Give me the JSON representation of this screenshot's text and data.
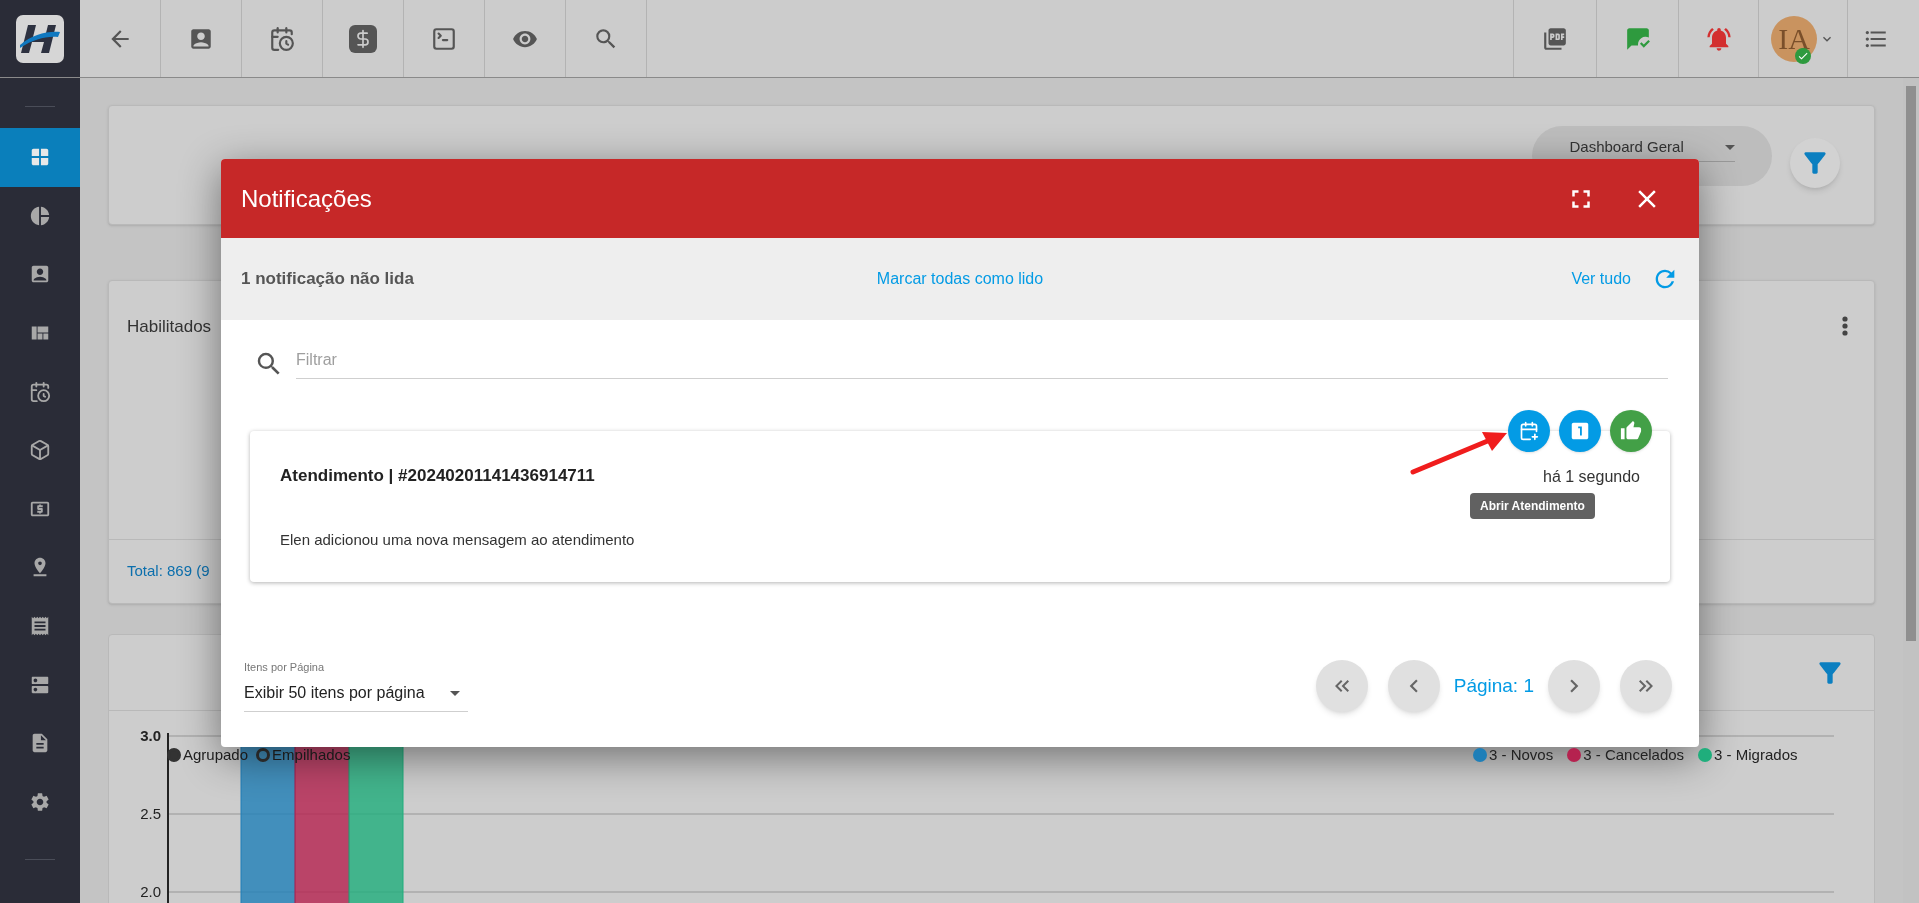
{
  "top_bar": {
    "avatar": {
      "initials": "IA"
    }
  },
  "sidebar": {
    "items": [
      {
        "selected": true
      },
      {
        "selected": false
      },
      {
        "selected": false
      },
      {
        "selected": false
      },
      {
        "selected": false
      },
      {
        "selected": false
      },
      {
        "selected": false
      },
      {
        "selected": false
      },
      {
        "selected": false
      },
      {
        "selected": false
      },
      {
        "selected": false
      }
    ]
  },
  "dashboard_header": {
    "select_value": "Dashboard Geral"
  },
  "habilitados_card": {
    "title": "Habilitados",
    "total": "Total: 869 (9"
  },
  "chart_card": {
    "view_options": [
      {
        "label": "Agrupado",
        "selected": true
      },
      {
        "label": "Empilhados",
        "selected": false
      }
    ],
    "axis_labels": [
      "3.0",
      "2.5",
      "2.0"
    ],
    "legend": [
      {
        "label": "3 - Novos",
        "color": "#1f7fb8"
      },
      {
        "label": "3 - Cancelados",
        "color": "#b5224f"
      },
      {
        "label": "3 - Migrados",
        "color": "#1fae7c"
      }
    ]
  },
  "notifications_dialog": {
    "title": "Notificações",
    "unread": "1 notificação não lida",
    "mark_all": "Marcar todas como lido",
    "see_all": "Ver tudo",
    "filter": {
      "placeholder": "Filtrar"
    },
    "notifications": [
      {
        "title": "Atendimento | #20240201141436914711",
        "message": "Elen adicionou uma nova mensagem ao atendimento",
        "time": "há 1 segundo",
        "tooltip": "Abrir Atendimento"
      }
    ],
    "page_size": {
      "label": "Itens por Página",
      "value": "Exibir 50 itens por página"
    },
    "page": "Página: 1"
  }
}
